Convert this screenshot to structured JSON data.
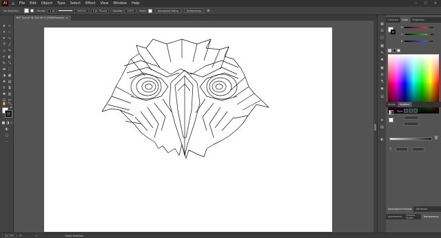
{
  "app": {
    "logo": "Ai",
    "menu": [
      "File",
      "Edit",
      "Object",
      "Type",
      "Select",
      "Effect",
      "View",
      "Window",
      "Help"
    ],
    "window_buttons": [
      "─",
      "☐",
      "✕"
    ]
  },
  "control_bar": {
    "selection_label": "No Selection",
    "stroke_label": "Stroke:",
    "stroke_value": "1 pt",
    "stroke_profile": "Uniform",
    "brush": "5 pt. Round",
    "opacity_label": "Opacity:",
    "opacity_value": "100%",
    "style_label": "Style:",
    "document_setup": "Document Setup",
    "preferences": "Preferences"
  },
  "document_tab": {
    "title": "BKT 3x4.ai* @ 104.56 % (RGB/Preview)",
    "close": "×"
  },
  "panels": {
    "top_tabs": [
      "Libraries",
      "Color",
      "Properties"
    ],
    "active_top_tab": "Color",
    "color_sliders": [
      {
        "label": "R",
        "color": "#ff3333"
      },
      {
        "label": "G",
        "color": "#33cc33"
      },
      {
        "label": "B",
        "color": "#3366ff"
      }
    ],
    "mid_tabs": [
      "Stroke",
      "Gradient"
    ],
    "active_mid_tab": "Gradient",
    "gradient_type_label": "Type:",
    "bottom_tabs_1": [
      "Separations Preview",
      "Attributes"
    ],
    "bottom_tabs_2": [
      "Appearance",
      "Graphic Styles",
      "Transparency"
    ],
    "active_bottom_tab_2": "Transparency"
  },
  "status_bar": {
    "zoom": "104.56%",
    "angle": "0°",
    "artboard": "1",
    "tool": "Group Selection"
  },
  "colors": {
    "ui_dark": "#323232",
    "ui_mid": "#424242",
    "canvas_bg": "#535353",
    "artboard": "#ffffff",
    "accent_orange": "#ff9a00"
  }
}
